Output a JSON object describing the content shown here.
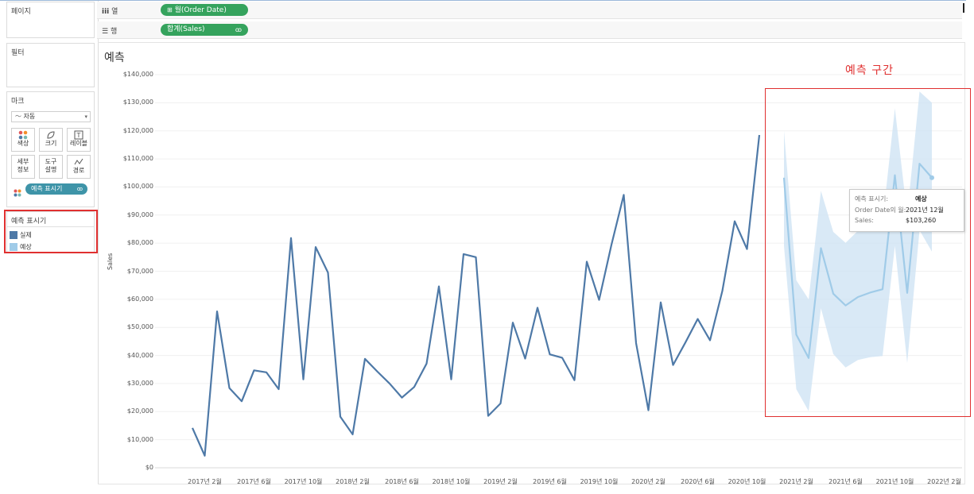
{
  "left_panels": {
    "pages_title": "페이지",
    "filters_title": "필터",
    "marks": {
      "title": "마크",
      "mark_type": "자동",
      "buttons": [
        {
          "label": "색상",
          "icon": "color-dots-icon"
        },
        {
          "label": "크기",
          "icon": "size-icon"
        },
        {
          "label": "레이블",
          "icon": "label-icon"
        },
        {
          "label": "세부\n정보",
          "icon": "detail-icon"
        },
        {
          "label": "도구\n설명",
          "icon": "tooltip-icon"
        },
        {
          "label": "경로",
          "icon": "path-icon"
        }
      ],
      "color_pill": "예측 표시기"
    },
    "legend": {
      "title": "예측 표시기",
      "items": [
        {
          "label": "실제",
          "color": "#4e79a7"
        },
        {
          "label": "예상",
          "color": "#a0cbe8"
        }
      ]
    }
  },
  "shelves": {
    "columns_label": "열",
    "columns_pill": "월(Order Date)",
    "rows_label": "행",
    "rows_pill": "합계(Sales)"
  },
  "sheet": {
    "title": "예측",
    "annotation": "예측 구간",
    "annotation_color": "#e03030"
  },
  "tooltip": {
    "rows": [
      {
        "key": "예측 표시기:",
        "value": "예상"
      },
      {
        "key": "Order Date의 월:",
        "value": "2021년 12월"
      },
      {
        "key": "Sales:",
        "value": "$103,260"
      }
    ]
  },
  "chart_data": {
    "type": "line",
    "title": "예측",
    "xlabel": "",
    "ylabel": "Sales",
    "ylim": [
      0,
      140000
    ],
    "y_ticks": [
      "$140,000",
      "$130,000",
      "$120,000",
      "$110,000",
      "$100,000",
      "$90,000",
      "$80,000",
      "$70,000",
      "$60,000",
      "$50,000",
      "$40,000",
      "$30,000",
      "$20,000",
      "$10,000",
      "$0"
    ],
    "y_tick_values": [
      140000,
      130000,
      120000,
      110000,
      100000,
      90000,
      80000,
      70000,
      60000,
      50000,
      40000,
      30000,
      20000,
      10000,
      0
    ],
    "x_ticks": [
      "2017년 2월",
      "2017년 6월",
      "2017년 10월",
      "2018년 2월",
      "2018년 6월",
      "2018년 10월",
      "2019년 2월",
      "2019년 6월",
      "2019년 10월",
      "2020년 2월",
      "2020년 6월",
      "2020년 10월",
      "2021년 2월",
      "2021년 6월",
      "2021년 10월",
      "2022년 2월"
    ],
    "x_tick_month_index": [
      1,
      5,
      9,
      13,
      17,
      21,
      25,
      29,
      33,
      37,
      41,
      45,
      49,
      53,
      57,
      61
    ],
    "grid": true,
    "series": [
      {
        "name": "실제",
        "color": "#4e79a7",
        "x_start": "2017년 1월",
        "values": [
          14200,
          4300,
          55700,
          28400,
          23700,
          34700,
          34000,
          28000,
          81800,
          31500,
          78600,
          69500,
          18200,
          11900,
          38800,
          34300,
          30000,
          25000,
          28800,
          37100,
          64600,
          31500,
          76100,
          75000,
          18500,
          22900,
          51700,
          38900,
          57000,
          40400,
          39200,
          31200,
          73400,
          59800,
          79400,
          97200,
          44400,
          20500,
          58900,
          36600,
          44600,
          53000,
          45400,
          63000,
          87800,
          77900,
          118500
        ]
      },
      {
        "name": "예상",
        "color": "#a0cbe8",
        "x_start": "2021년 1월",
        "values": [
          103300,
          47400,
          39100,
          78200,
          62000,
          57800,
          60800,
          62400,
          63600,
          104200,
          62300,
          108300,
          103300
        ],
        "lower": [
          79000,
          28000,
          20200,
          56800,
          40500,
          35700,
          38400,
          39400,
          39800,
          79000,
          37300,
          84600,
          77000
        ],
        "upper": [
          120000,
          66800,
          60000,
          98600,
          84000,
          80100,
          84400,
          85500,
          87500,
          128000,
          90000,
          134000,
          130000
        ]
      }
    ]
  }
}
